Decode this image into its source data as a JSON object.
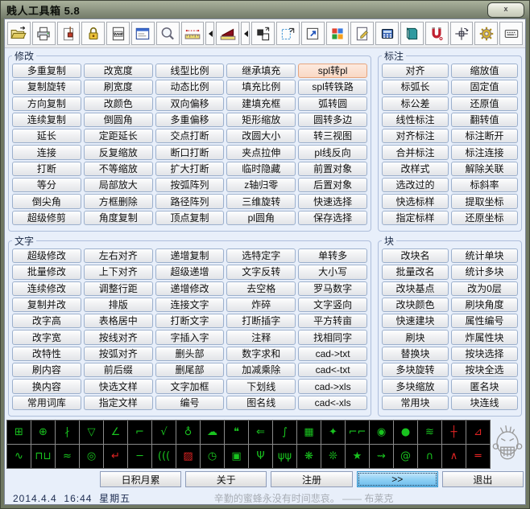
{
  "window": {
    "title": "贱人工具箱 5.8",
    "close_label": "x"
  },
  "toolbar": {
    "icons": [
      "open-file-icon",
      "print-icon",
      "purge-brush-icon",
      "lock-icon",
      "wmf-export-icon",
      "form-icon",
      "zoom-icon",
      "measure-icon",
      "measure-dropdown",
      "area-icon",
      "area-dropdown",
      "scale-boxes-icon",
      "selection-scale-icon",
      "shortcut-icon",
      "color-blocks-icon",
      "edit-note-icon",
      "calculator-icon",
      "notebook-icon",
      "magnet-icon",
      "coordinate-icon",
      "gear-icon",
      "keyboard-icon"
    ]
  },
  "groups": {
    "modify": {
      "title": "修改",
      "items": [
        "多重复制",
        "复制旋转",
        "方向复制",
        "连续复制",
        "延长",
        "连接",
        "打断",
        "等分",
        "倒尖角",
        "超级修剪",
        "改宽度",
        "刷宽度",
        "改颜色",
        "倒圆角",
        "定距延长",
        "反复缩放",
        "不等缩放",
        "局部放大",
        "方框删除",
        "角度复制",
        "线型比例",
        "动态比例",
        "双向偏移",
        "多重偏移",
        "交点打断",
        "断口打断",
        "扩大打断",
        "按弧阵列",
        "路径阵列",
        "顶点复制",
        "继承填充",
        "填充比例",
        "建填充框",
        "矩形缩放",
        "改圆大小",
        "夹点拉伸",
        "临时隐藏",
        "z轴归零",
        "三维旋转",
        "pl圆角",
        {
          "label": "spl转pl",
          "highlight": true
        },
        "spl转铁路",
        "弧转圆",
        "圆转多边",
        "转三视图",
        "pl线反向",
        "前置对象",
        "后置对象",
        "快速选择",
        "保存选择"
      ]
    },
    "dimension": {
      "title": "标注",
      "items": [
        "对齐",
        "标弧长",
        "标公差",
        "线性标注",
        "对齐标注",
        "合并标注",
        "改样式",
        "选改过的",
        "快选标样",
        "指定标样",
        "缩放值",
        "固定值",
        "还原值",
        "翻转值",
        "标注断开",
        "标注连接",
        "解除关联",
        "标斜率",
        "提取坐标",
        "还原坐标"
      ]
    },
    "text": {
      "title": "文字",
      "items": [
        "超级修改",
        "批量修改",
        "连续修改",
        "复制并改",
        "改字高",
        "改字宽",
        "改特性",
        "刷内容",
        "换内容",
        "常用词库",
        "左右对齐",
        "上下对齐",
        "调整行距",
        "排版",
        "表格居中",
        "按线对齐",
        "按弧对齐",
        "前后缀",
        "快选文样",
        "指定文样",
        "递增复制",
        "超级递增",
        "递增修改",
        "连接文字",
        "打断文字",
        "字插入字",
        "删头部",
        "删尾部",
        "文字加框",
        "编号",
        "选特定字",
        "文字反转",
        "去空格",
        "炸碎",
        "打断插字",
        "注释",
        "数字求和",
        "加减乘除",
        "下划线",
        "图名线",
        "单转多",
        "大小写",
        "罗马数字",
        "文字竖向",
        "平方转亩",
        "找相同字",
        "cad->txt",
        "cad<-txt",
        "cad->xls",
        "cad<-xls"
      ]
    },
    "block": {
      "title": "块",
      "items": [
        "改块名",
        "批量改名",
        "改块基点",
        "改块颜色",
        "快速建块",
        "刷块",
        "替换块",
        "多块旋转",
        "多块缩放",
        "常用块",
        "统计单块",
        "统计多块",
        "改为0层",
        "刷块角度",
        "属性编号",
        "炸属性块",
        "按块选择",
        "按块全选",
        "匿名块",
        "块连线"
      ]
    }
  },
  "icon_panel": {
    "items": [
      {
        "name": "axis-square-icon",
        "glyph": "⊞"
      },
      {
        "name": "axis-circle-icon",
        "glyph": "⊕"
      },
      {
        "name": "section-line-icon",
        "glyph": "∤"
      },
      {
        "name": "roughness-icon",
        "glyph": "▽"
      },
      {
        "name": "slope-ratio-icon",
        "glyph": "∠"
      },
      {
        "name": "elevation-mark-icon",
        "glyph": "⌐"
      },
      {
        "name": "weld-mark-icon",
        "glyph": "√"
      },
      {
        "name": "survey-point-icon",
        "glyph": "♁"
      },
      {
        "name": "revision-cloud-icon",
        "glyph": "☁"
      },
      {
        "name": "callout-icon",
        "glyph": "❝"
      },
      {
        "name": "break-arrow-icon",
        "glyph": "⇐"
      },
      {
        "name": "curve-graph-icon",
        "glyph": "∫"
      },
      {
        "name": "table-icon",
        "glyph": "▦"
      },
      {
        "name": "four-star-icon",
        "glyph": "✦"
      },
      {
        "name": "stairs-icon",
        "glyph": "⌐⌐"
      },
      {
        "name": "north-arrow-icon",
        "glyph": "◉"
      },
      {
        "name": "point-icon",
        "glyph": "●"
      },
      {
        "name": "spring-icon",
        "glyph": "≋"
      },
      {
        "name": "cross-mark-icon",
        "glyph": "┼",
        "color": "red"
      },
      {
        "name": "slope-line-icon",
        "glyph": "⊿",
        "color": "red"
      },
      {
        "name": "sine-wave-icon",
        "glyph": "∿"
      },
      {
        "name": "square-wave-icon",
        "glyph": "⊓⊔"
      },
      {
        "name": "zigzag-icon",
        "glyph": "≈"
      },
      {
        "name": "concentric-circle-icon",
        "glyph": "◎"
      },
      {
        "name": "leader-hook-icon",
        "glyph": "↵",
        "color": "red"
      },
      {
        "name": "line-segment-icon",
        "glyph": "─"
      },
      {
        "name": "coil-icon",
        "glyph": "((("
      },
      {
        "name": "hatch-box-icon",
        "glyph": "▨",
        "color": "red"
      },
      {
        "name": "clock-icon",
        "glyph": "◷"
      },
      {
        "name": "label-box-icon",
        "glyph": "▣"
      },
      {
        "name": "branch-icon",
        "glyph": "Ψ"
      },
      {
        "name": "grass-icon",
        "glyph": "ψψ"
      },
      {
        "name": "gear-star-icon",
        "glyph": "❋"
      },
      {
        "name": "gear-star2-icon",
        "glyph": "❊"
      },
      {
        "name": "star-circle-icon",
        "glyph": "★"
      },
      {
        "name": "step-leader-icon",
        "glyph": "⇝"
      },
      {
        "name": "spiral-icon",
        "glyph": "@"
      },
      {
        "name": "arc-points-icon",
        "glyph": "∩"
      },
      {
        "name": "roof-line-icon",
        "glyph": "∧",
        "color": "red"
      },
      {
        "name": "parallel-lines-icon",
        "glyph": "═",
        "color": "red"
      }
    ]
  },
  "footer": {
    "buttons": [
      {
        "name": "daily-tips-button",
        "label": "日积月累"
      },
      {
        "name": "about-button",
        "label": "关于"
      },
      {
        "name": "register-button",
        "label": "注册"
      },
      {
        "name": "expand-button",
        "label": ">>",
        "highlight": true
      },
      {
        "name": "exit-button",
        "label": "退出"
      }
    ]
  },
  "statusbar": {
    "date": "2014.4.4",
    "time": "16:44",
    "weekday": "星期五",
    "quote": "辛勤的蜜蜂永没有时间悲哀。 —— 布莱克"
  },
  "colors": {
    "highlight_fill": "#f9d8c4",
    "highlight_border": "#e6a57e",
    "focus_blue": "#6cbdec",
    "panel_green": "#19c31f",
    "panel_red": "#e02424"
  }
}
